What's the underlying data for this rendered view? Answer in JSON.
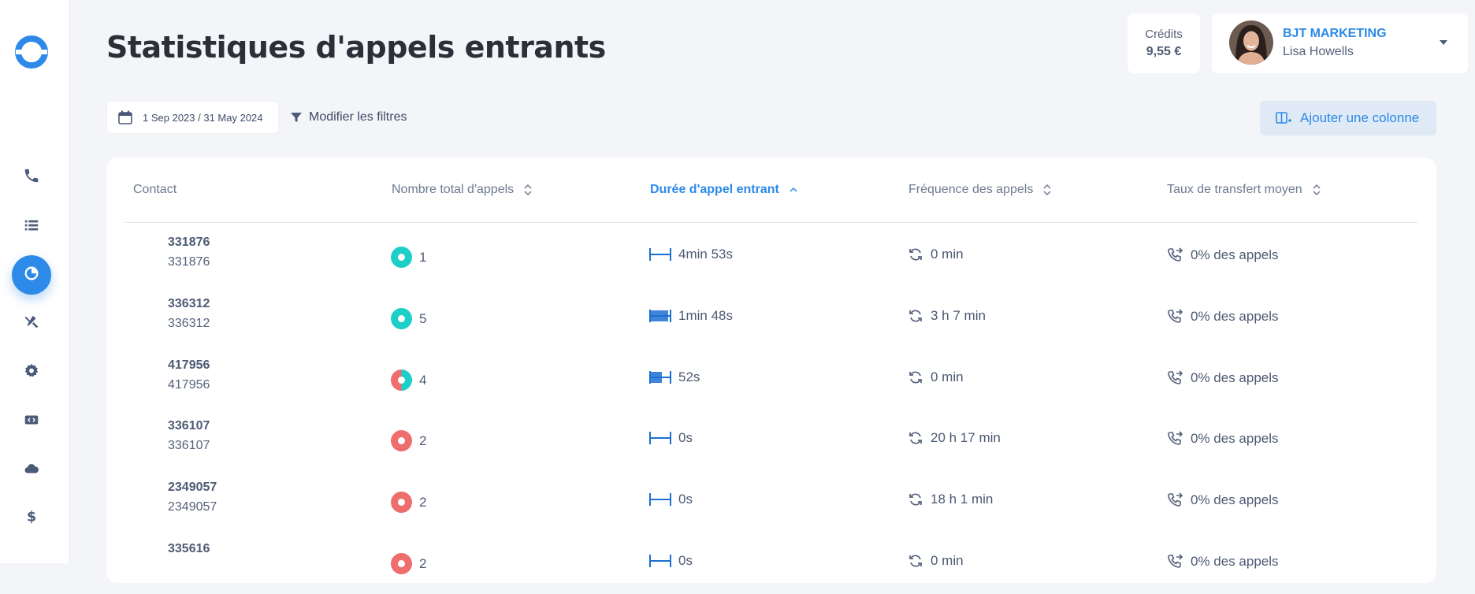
{
  "header": {
    "title": "Statistiques d'appels entrants",
    "credits_label": "Crédits",
    "credits_value": "9,55 €",
    "company": "BJT MARKETING",
    "user": "Lisa Howells"
  },
  "filters": {
    "date_range": "1 Sep 2023 / 31 May 2024",
    "modify_label": "Modifier les filtres",
    "add_column_label": "Ajouter une colonne"
  },
  "sidebar": {
    "items": [
      {
        "icon": "phone-icon"
      },
      {
        "icon": "list-icon"
      },
      {
        "icon": "pie-chart-icon",
        "active": true
      },
      {
        "icon": "tools-icon"
      },
      {
        "icon": "gear-icon"
      },
      {
        "icon": "code-icon"
      },
      {
        "icon": "cloud-icon"
      },
      {
        "icon": "dollar-icon"
      }
    ]
  },
  "colors": {
    "accent": "#2d8ae8",
    "teal": "#1ccfc9",
    "red": "#ee6e6e",
    "bar_blue": "#1d6fd1"
  },
  "table": {
    "columns": {
      "contact": "Contact",
      "total": "Nombre total d'appels",
      "duration": "Durée d'appel entrant",
      "frequency": "Fréquence des appels",
      "transfer": "Taux de transfert moyen"
    },
    "rows": [
      {
        "contact_name": "331876",
        "contact_number": "331876",
        "total": "1",
        "total_answered_ratio": 1.0,
        "duration": "4min 53s",
        "duration_fill": 0.0,
        "frequency": "0 min",
        "transfer": "0% des appels"
      },
      {
        "contact_name": "336312",
        "contact_number": "336312",
        "total": "5",
        "total_answered_ratio": 1.0,
        "duration": "1min 48s",
        "duration_fill": 1.0,
        "frequency": "3 h 7 min",
        "transfer": "0% des appels"
      },
      {
        "contact_name": "417956",
        "contact_number": "417956",
        "total": "4",
        "total_answered_ratio": 0.5,
        "duration": "52s",
        "duration_fill": 0.65,
        "frequency": "0 min",
        "transfer": "0% des appels"
      },
      {
        "contact_name": "336107",
        "contact_number": "336107",
        "total": "2",
        "total_answered_ratio": 0.0,
        "duration": "0s",
        "duration_fill": 0.0,
        "frequency": "20 h 17 min",
        "transfer": "0% des appels"
      },
      {
        "contact_name": "2349057",
        "contact_number": "2349057",
        "total": "2",
        "total_answered_ratio": 0.0,
        "duration": "0s",
        "duration_fill": 0.0,
        "frequency": "18 h 1 min",
        "transfer": "0% des appels"
      },
      {
        "contact_name": "335616",
        "contact_number": "",
        "total": "2",
        "total_answered_ratio": 0.0,
        "duration": "0s",
        "duration_fill": 0.0,
        "frequency": "0 min",
        "transfer": "0% des appels"
      }
    ]
  }
}
